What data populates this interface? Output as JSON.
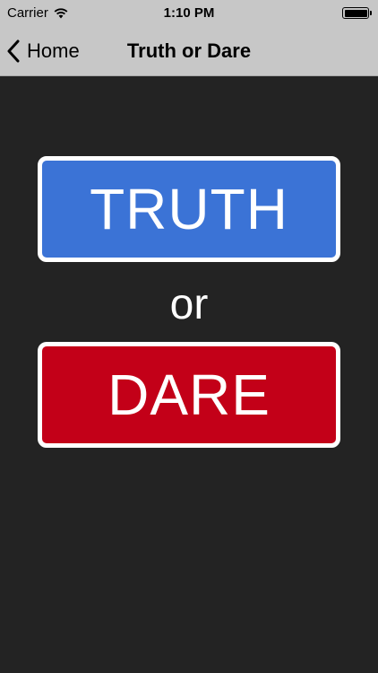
{
  "status_bar": {
    "carrier": "Carrier",
    "time": "1:10 PM",
    "battery_level": 1.0
  },
  "nav": {
    "back_label": "Home",
    "title": "Truth or Dare"
  },
  "main": {
    "truth_label": "TRUTH",
    "or_label": "or",
    "dare_label": "DARE"
  },
  "colors": {
    "background": "#232323",
    "bar": "#c7c7c7",
    "truth": "#3b73d6",
    "dare": "#c30018",
    "border": "#ffffff"
  },
  "icons": {
    "wifi": "wifi-icon",
    "back": "chevron-left-icon",
    "battery": "battery-icon"
  }
}
